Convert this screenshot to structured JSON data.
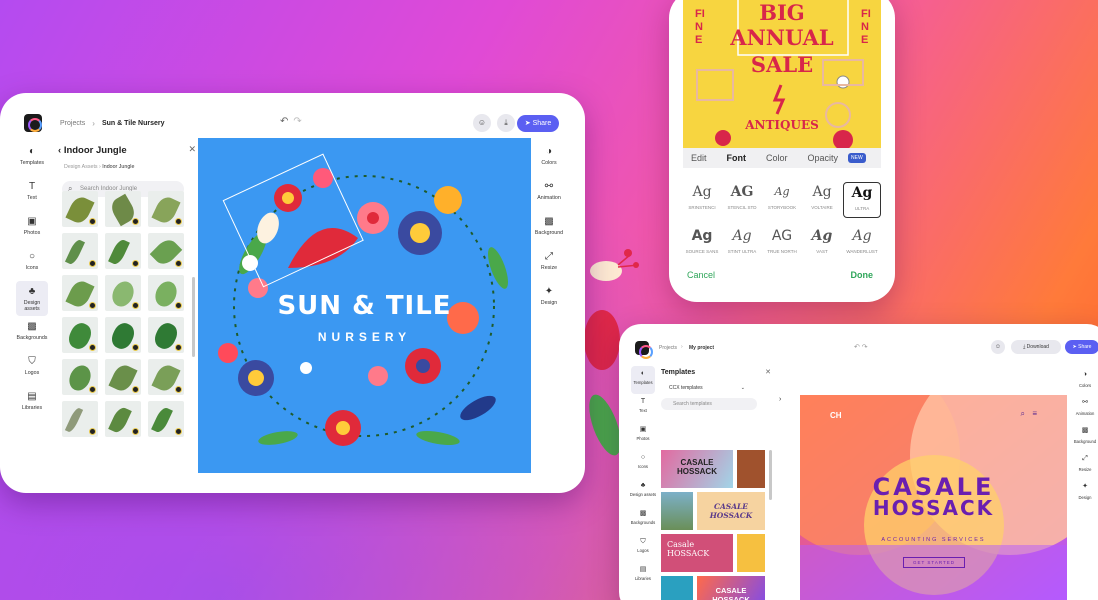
{
  "tablet1": {
    "breadcrumb": {
      "root": "Projects",
      "current": "Sun & Tile Nursery"
    },
    "share_label": "Share",
    "left_rail": [
      {
        "label": "Templates",
        "icon": "templates-icon"
      },
      {
        "label": "Text",
        "icon": "text-icon"
      },
      {
        "label": "Photos",
        "icon": "photos-icon"
      },
      {
        "label": "Icons",
        "icon": "icons-icon"
      },
      {
        "label": "Design assets",
        "icon": "design-assets-icon"
      },
      {
        "label": "Backgrounds",
        "icon": "backgrounds-icon"
      },
      {
        "label": "Logos",
        "icon": "logos-icon"
      },
      {
        "label": "Libraries",
        "icon": "libraries-icon"
      }
    ],
    "panel": {
      "title": "Indoor Jungle",
      "crumb_root": "Design Assets",
      "crumb_current": "Indoor Jungle",
      "search_placeholder": "Search Indoor Jungle"
    },
    "right_rail": [
      {
        "label": "Colors"
      },
      {
        "label": "Animation"
      },
      {
        "label": "Background"
      },
      {
        "label": "Resize"
      },
      {
        "label": "Design"
      }
    ],
    "canvas": {
      "title": "SUN & TILE",
      "subtitle": "NURSERY",
      "background": "#3b98f2"
    }
  },
  "phone": {
    "poster": {
      "line1": "BIG",
      "line2": "ANNUAL",
      "line3": "SALE",
      "side_left": "FINE",
      "side_right": "FINE",
      "bottom": "ANTIQUES"
    },
    "tabs": [
      "Edit",
      "Font",
      "Color",
      "Opacity"
    ],
    "active_tab": "Font",
    "new_badge": "NEW",
    "fonts": [
      {
        "glyph": "Ag",
        "name": "SRINSTENCI"
      },
      {
        "glyph": "AG",
        "name": "STENCIL STD"
      },
      {
        "glyph": "Ag",
        "name": "STORYBOOK"
      },
      {
        "glyph": "Ag",
        "name": "VOLTAIRE"
      },
      {
        "glyph": "Ag",
        "name": "ULTRA"
      },
      {
        "glyph": "Ag",
        "name": "SOURCE SANS"
      },
      {
        "glyph": "Ag",
        "name": "STINT ULTRA"
      },
      {
        "glyph": "AG",
        "name": "TRUE NORTH"
      },
      {
        "glyph": "Ag",
        "name": "VAST"
      },
      {
        "glyph": "Ag",
        "name": "WANDERLUST"
      }
    ],
    "selected_font": "ULTRA",
    "cancel_label": "Cancel",
    "done_label": "Done"
  },
  "tablet2": {
    "breadcrumb": {
      "root": "Projects",
      "current": "My project"
    },
    "download_label": "Download",
    "share_label": "Share",
    "left_rail": [
      "Templates",
      "Text",
      "Photos",
      "Icons",
      "Design assets",
      "Backgrounds",
      "Logos",
      "Libraries"
    ],
    "right_rail": [
      "Colors",
      "Animation",
      "Background",
      "Resize",
      "Design"
    ],
    "panel": {
      "title": "Templates",
      "dropdown": "CCX templates",
      "search_placeholder": "Search templates",
      "thumb_texts": [
        "CASALE HOSSACK",
        "CASALE HOSSACK",
        "Casale HOSSACK",
        "CASALE HOSSACK"
      ]
    },
    "canvas": {
      "logo": "CH",
      "title_line1": "CASALE",
      "title_line2": "HOSSACK",
      "tagline": "ACCOUNTING SERVICES",
      "cta": "GET STARTED"
    }
  },
  "colors": {
    "accent": "#5b5ff2",
    "poster_yellow": "#f7d540",
    "poster_red": "#d8264a",
    "done_green": "#2fa65a",
    "casale_purple": "#6a1fb0"
  }
}
